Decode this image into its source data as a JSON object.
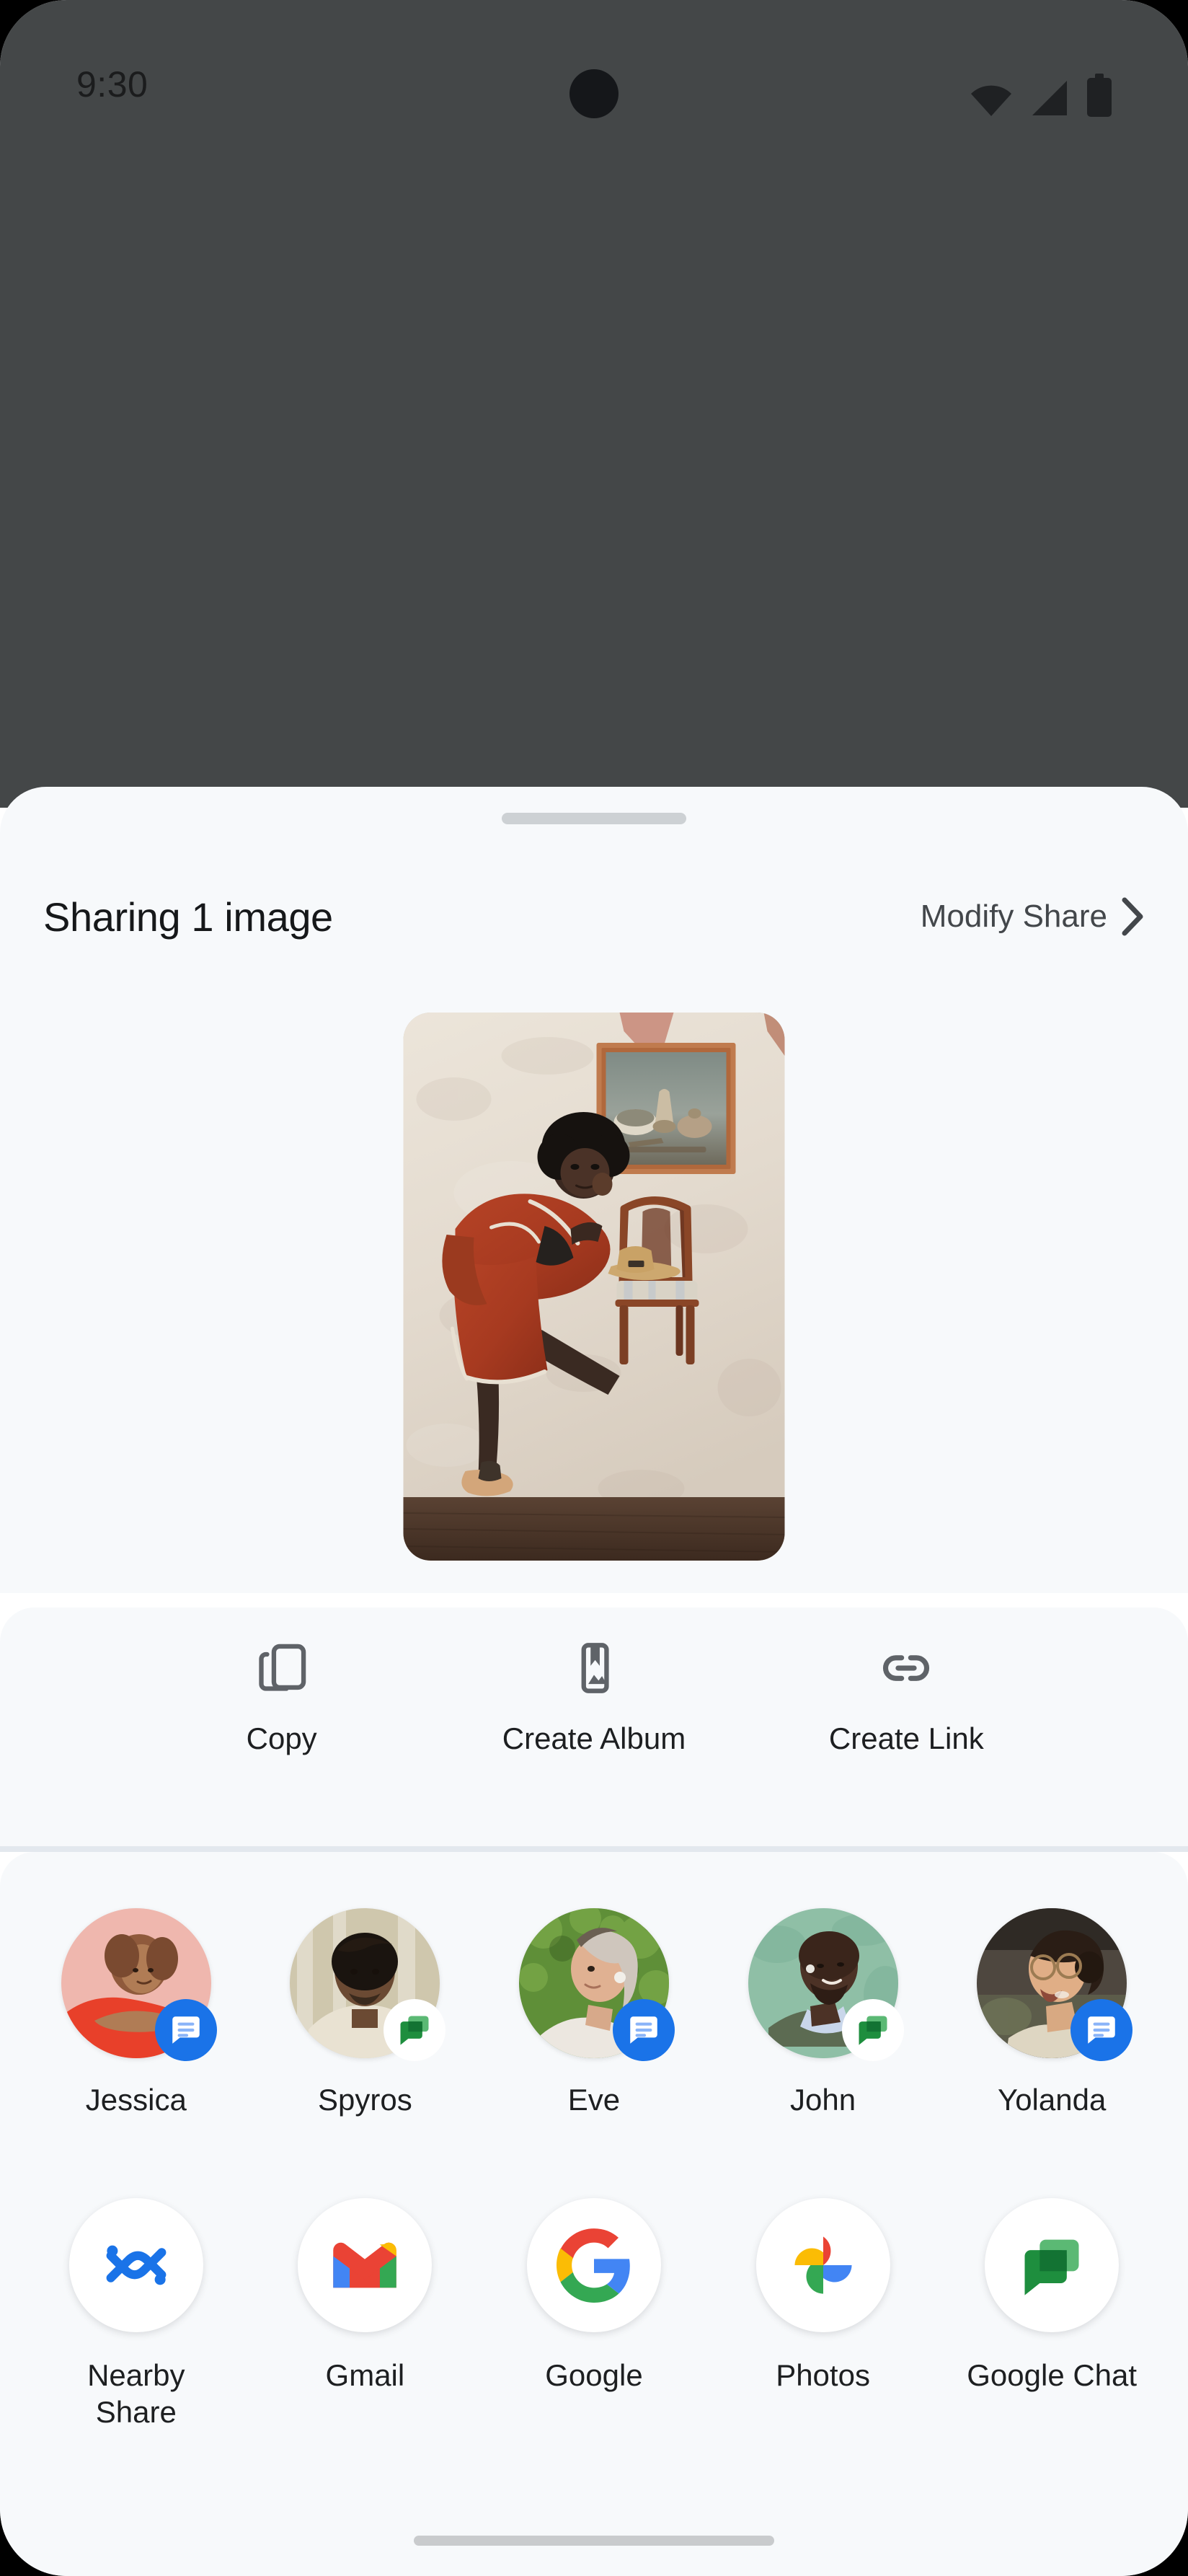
{
  "statusbar": {
    "time": "9:30",
    "icons": [
      "wifi-icon",
      "cell-signal-icon",
      "battery-icon"
    ]
  },
  "sheet": {
    "title": "Sharing 1 image",
    "modify_share_label": "Modify Share",
    "chevron_icon": "chevron-right-icon",
    "drag_handle": "drag-handle",
    "preview_image_alt": "Woman in red coat leaning on wooden chair in front of white textured wall with framed still-life painting"
  },
  "actions": [
    {
      "label": "Copy",
      "icon": "copy-icon"
    },
    {
      "label": "Create Album",
      "icon": "create-album-icon"
    },
    {
      "label": "Create Link",
      "icon": "link-icon"
    }
  ],
  "contacts": [
    {
      "name": "Jessica",
      "badge": "messages-icon",
      "badge_style": "blue"
    },
    {
      "name": "Spyros",
      "badge": "google-chat-icon",
      "badge_style": "white"
    },
    {
      "name": "Eve",
      "badge": "messages-icon",
      "badge_style": "blue"
    },
    {
      "name": "John",
      "badge": "google-chat-icon",
      "badge_style": "white"
    },
    {
      "name": "Yolanda",
      "badge": "messages-icon",
      "badge_style": "blue"
    }
  ],
  "apps": [
    {
      "name": "Nearby Share",
      "icon": "nearby-share-icon"
    },
    {
      "name": "Gmail",
      "icon": "gmail-icon"
    },
    {
      "name": "Google",
      "icon": "google-icon"
    },
    {
      "name": "Photos",
      "icon": "google-photos-icon"
    },
    {
      "name": "Google Chat",
      "icon": "google-chat-icon"
    }
  ],
  "colors": {
    "scrim": "#444748",
    "sheet_bg": "#f7f9fb",
    "messages_blue": "#1a73e8",
    "chat_green": "#1e8e3e",
    "divider": "#e3e8ee",
    "text_primary": "#1d1f21",
    "text_secondary": "#43474b"
  },
  "nav": {
    "handle": "gesture-nav-handle"
  }
}
